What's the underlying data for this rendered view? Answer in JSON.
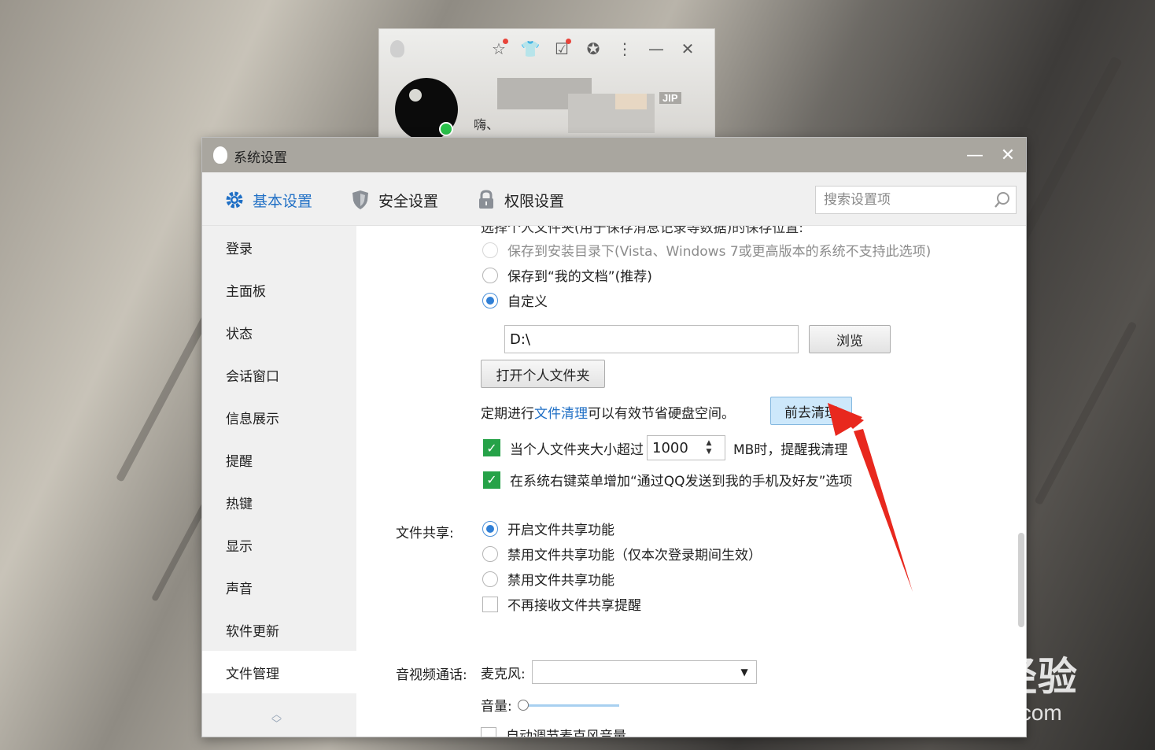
{
  "qq_panel": {
    "nickname": "嗨、",
    "badge": "JIP",
    "icons": [
      "star-icon",
      "shirt-icon",
      "checklist-icon",
      "medal-icon",
      "more-icon",
      "minimize-icon",
      "close-icon"
    ]
  },
  "window": {
    "title": "系统设置",
    "minimize_glyph": "—",
    "close_glyph": "✕"
  },
  "tabs": [
    {
      "label": "基本设置",
      "icon": "gear-icon",
      "active": true
    },
    {
      "label": "安全设置",
      "icon": "shield-icon",
      "active": false
    },
    {
      "label": "权限设置",
      "icon": "lock-icon",
      "active": false
    }
  ],
  "search": {
    "placeholder": "搜索设置项"
  },
  "sidebar": {
    "items": [
      {
        "label": "登录"
      },
      {
        "label": "主面板"
      },
      {
        "label": "状态"
      },
      {
        "label": "会话窗口"
      },
      {
        "label": "信息展示"
      },
      {
        "label": "提醒"
      },
      {
        "label": "热键"
      },
      {
        "label": "显示"
      },
      {
        "label": "声音"
      },
      {
        "label": "软件更新"
      },
      {
        "label": "文件管理",
        "active": true
      }
    ]
  },
  "content": {
    "cut_heading": "选择个人文件夹(用于保存消息记录等数据)的保存位置:",
    "save_options": [
      {
        "label": "保存到安装目录下(Vista、Windows 7或更高版本的系统不支持此选项)",
        "state": "disabled"
      },
      {
        "label": "保存到“我的文档”(推荐)",
        "state": "unchecked"
      },
      {
        "label": "自定义",
        "state": "checked"
      }
    ],
    "path_value": "D:\\",
    "browse_button": "浏览",
    "open_folder_button": "打开个人文件夹",
    "cleanup_prefix": "定期进行",
    "cleanup_link": "文件清理",
    "cleanup_suffix": "可以有效节省硬盘空间。",
    "cleanup_button": "前去清理",
    "size_check_prefix": "当个人文件夹大小超过",
    "size_value": "1000",
    "size_check_suffix": "MB时，提醒我清理",
    "context_menu_check": "在系统右键菜单增加“通过QQ发送到我的手机及好友”选项",
    "file_share_label": "文件共享:",
    "share_options": [
      {
        "label": "开启文件共享功能",
        "state": "checked"
      },
      {
        "label": "禁用文件共享功能（仅本次登录期间生效）",
        "state": "unchecked"
      },
      {
        "label": "禁用文件共享功能",
        "state": "unchecked"
      }
    ],
    "share_reminder_check": "不再接收文件共享提醒",
    "av_label": "音视频通话:",
    "mic_label": "麦克风:",
    "mic_value": "",
    "volume_label": "音量:",
    "volume_level": 0,
    "auto_adjust_check": "自动调节麦克风音量"
  },
  "watermark": {
    "big": "Baidu经验",
    "small": "jingyan.baidu.com"
  },
  "colors": {
    "accent": "#1f6fc5",
    "checkbox_green": "#26a248",
    "arrow_red": "#e8281e",
    "titlebar": "#a9a69f"
  }
}
